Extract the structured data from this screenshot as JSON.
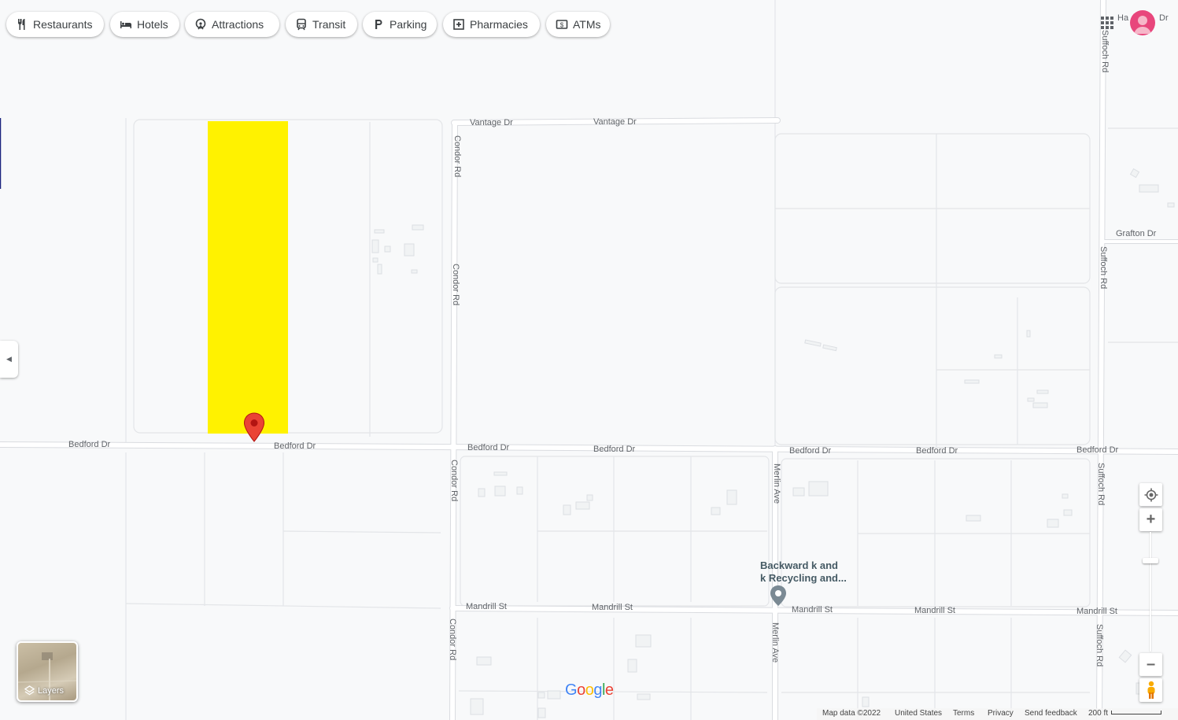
{
  "chips": [
    {
      "label": "Restaurants",
      "icon": "restaurant-icon"
    },
    {
      "label": "Hotels",
      "icon": "hotel-icon"
    },
    {
      "label": "Attractions",
      "icon": "attractions-icon"
    },
    {
      "label": "Transit",
      "icon": "transit-icon"
    },
    {
      "label": "Parking",
      "icon": "parking-icon"
    },
    {
      "label": "Pharmacies",
      "icon": "pharmacy-icon"
    },
    {
      "label": "ATMs",
      "icon": "atm-icon"
    }
  ],
  "streets": {
    "vantage1": "Vantage Dr",
    "vantage2": "Vantage Dr",
    "bedford1": "Bedford Dr",
    "bedford2": "Bedford Dr",
    "bedford3": "Bedford Dr",
    "bedford4": "Bedford Dr",
    "bedford5": "Bedford Dr",
    "bedford6": "Bedford Dr",
    "bedford7": "Bedford Dr",
    "mandrill1": "Mandrill St",
    "mandrill2": "Mandrill St",
    "mandrill3": "Mandrill St",
    "mandrill4": "Mandrill St",
    "mandrill5": "Mandrill St",
    "condor1": "Condor Rd",
    "condor2": "Condor Rd",
    "condor3": "Condor Rd",
    "condor4": "Condor Rd",
    "merlin1": "Merlin Ave",
    "merlin2": "Merlin Ave",
    "suffoch1": "Suffoch Rd",
    "suffoch2": "Suffoch Rd",
    "suffoch3": "Suffoch Rd",
    "suffoch4": "Suffoch Rd",
    "grafton": "Grafton Dr",
    "topright_a": "Ha",
    "topright_b": "Dr"
  },
  "poi": {
    "line1": "Backward k and",
    "line2": "k Recycling and..."
  },
  "layers_label": "Layers",
  "google_logo": [
    "G",
    "o",
    "o",
    "g",
    "l",
    "e"
  ],
  "logo_colors": [
    "#4285F4",
    "#EA4335",
    "#FBBC05",
    "#4285F4",
    "#34A853",
    "#EA4335"
  ],
  "footer": {
    "map_data": "Map data ©2022",
    "country": "United States",
    "terms": "Terms",
    "privacy": "Privacy",
    "feedback": "Send feedback",
    "scale": "200 ft"
  },
  "colors": {
    "highlight": "#fff200",
    "pin": "#ea4335",
    "poi_pin": "#7b8a94",
    "avatar": "#e8467c"
  }
}
